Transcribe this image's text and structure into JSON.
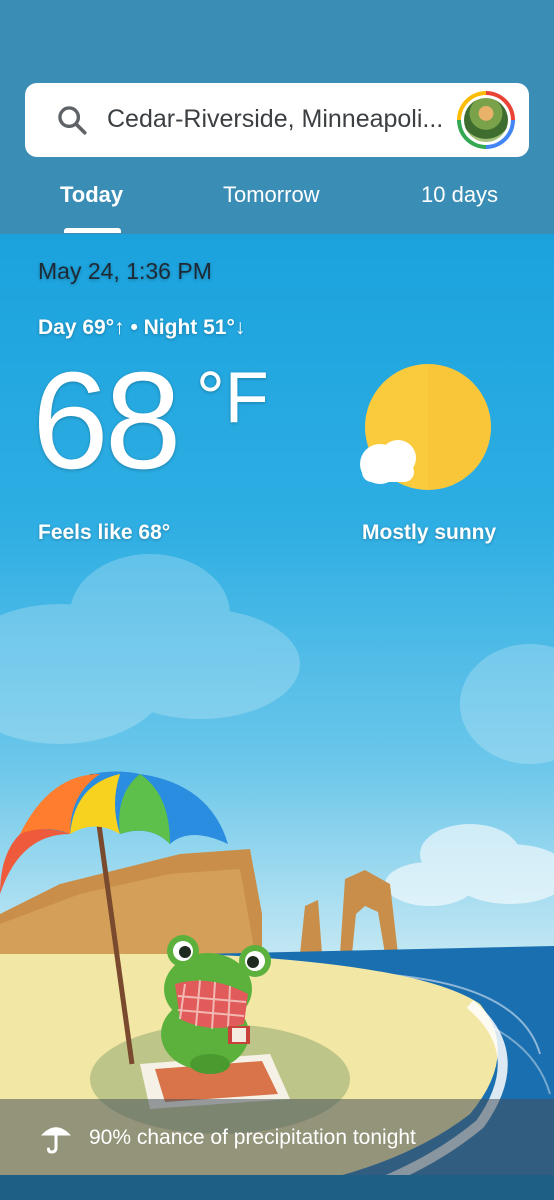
{
  "search": {
    "location": "Cedar-Riverside, Minneapoli..."
  },
  "tabs": [
    {
      "label": "Today",
      "selected": true
    },
    {
      "label": "Tomorrow",
      "selected": false
    },
    {
      "label": "10 days",
      "selected": false
    }
  ],
  "weather": {
    "datetime": "May 24, 1:36 PM",
    "day_night": "Day 69°↑ • Night 51°↓",
    "temperature": "68",
    "unit": "°F",
    "feels_like": "Feels like 68°",
    "condition": "Mostly sunny",
    "condition_icon": "mostly-sunny-icon"
  },
  "precipitation": {
    "text": "90% chance of precipitation tonight",
    "icon": "umbrella-icon"
  },
  "colors": {
    "header": "#3a8db4",
    "sky": "#1ba2dd",
    "sun": "#fbcb3e",
    "sea": "#1a6fb0",
    "sand": "#f3e7a5",
    "frog": "#5cb13d"
  }
}
